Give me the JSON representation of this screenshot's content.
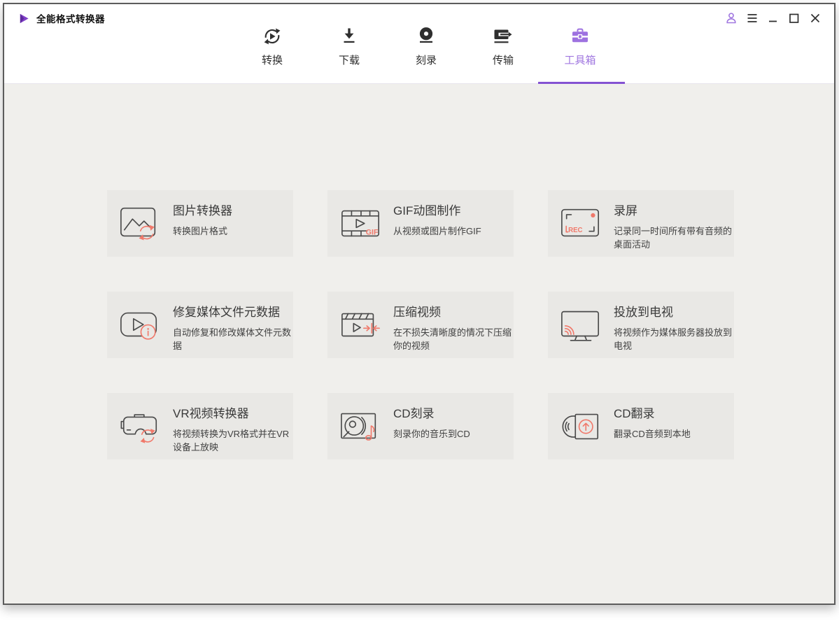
{
  "window": {
    "title": "全能格式转换器",
    "controls": [
      "account",
      "menu",
      "minimize",
      "maximize",
      "close"
    ]
  },
  "nav": {
    "tabs": [
      {
        "label": "转换",
        "icon": "convert-icon",
        "active": false
      },
      {
        "label": "下载",
        "icon": "download-icon",
        "active": false
      },
      {
        "label": "刻录",
        "icon": "burn-icon",
        "active": false
      },
      {
        "label": "传输",
        "icon": "transfer-icon",
        "active": false
      },
      {
        "label": "工具箱",
        "icon": "toolbox-icon",
        "active": true
      }
    ]
  },
  "toolbox": {
    "cards": [
      {
        "title": "图片转换器",
        "description": "转换图片格式",
        "icon": "image-converter-icon"
      },
      {
        "title": "GIF动图制作",
        "description": "从视频或图片制作GIF",
        "icon": "gif-maker-icon",
        "icon_text": "GIF"
      },
      {
        "title": "录屏",
        "description": "记录同一时间所有带有音频的桌面活动",
        "icon": "screen-record-icon",
        "icon_text": "REC"
      },
      {
        "title": "修复媒体文件元数据",
        "description": "自动修复和修改媒体文件元数据",
        "icon": "fix-metadata-icon"
      },
      {
        "title": "压缩视频",
        "description": "在不损失清晰度的情况下压缩你的视频",
        "icon": "compress-video-icon"
      },
      {
        "title": "投放到电视",
        "description": "将视频作为媒体服务器投放到电视",
        "icon": "cast-to-tv-icon"
      },
      {
        "title": "VR视频转换器",
        "description": "将视频转换为VR格式并在VR设备上放映",
        "icon": "vr-converter-icon"
      },
      {
        "title": "CD刻录",
        "description": "刻录你的音乐到CD",
        "icon": "cd-burn-icon"
      },
      {
        "title": "CD翻录",
        "description": "翻录CD音频到本地",
        "icon": "cd-rip-icon"
      }
    ]
  },
  "colors": {
    "accent_purple": "#a178e0",
    "underline_purple": "#8452d2",
    "coral": "#f0796b",
    "icon_dark": "#4a4a4a",
    "card_bg": "#e9e8e5",
    "content_bg": "#f0efec"
  }
}
